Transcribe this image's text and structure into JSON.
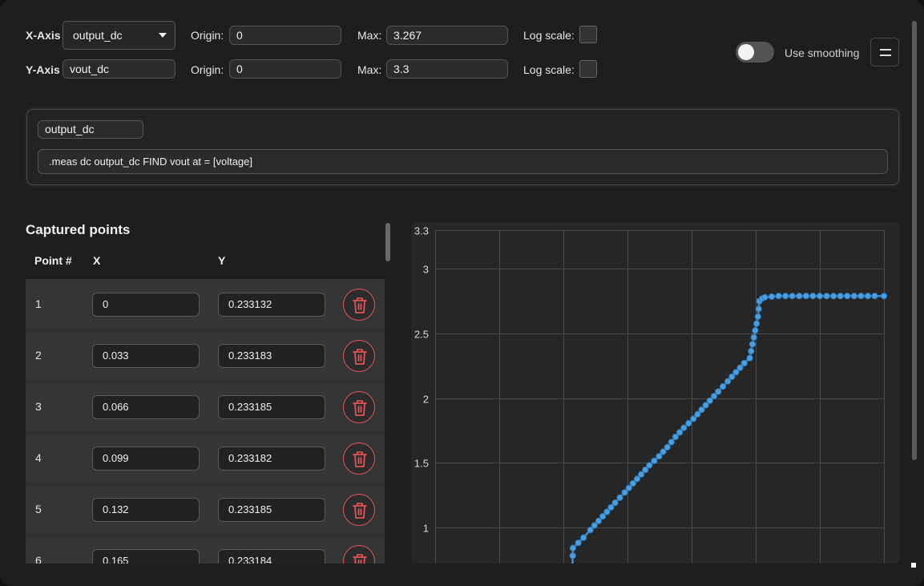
{
  "axes": {
    "x": {
      "label": "X-Axis",
      "selected": "output_dc",
      "origin_label": "Origin:",
      "origin": "0",
      "max_label": "Max:",
      "max": "3.267",
      "log_label": "Log scale:"
    },
    "y": {
      "label": "Y-Axis",
      "value": "vout_dc",
      "origin_label": "Origin:",
      "origin": "0",
      "max_label": "Max:",
      "max": "3.3",
      "log_label": "Log scale:"
    }
  },
  "smoothing_label": "Use smoothing",
  "measurement": {
    "name": "output_dc",
    "command": ".meas dc output_dc FIND vout at = [voltage]"
  },
  "points": {
    "title": "Captured points",
    "headers": {
      "num": "Point #",
      "x": "X",
      "y": "Y"
    },
    "rows": [
      {
        "n": "1",
        "x": "0",
        "y": "0.233132"
      },
      {
        "n": "2",
        "x": "0.033",
        "y": "0.233183"
      },
      {
        "n": "3",
        "x": "0.066",
        "y": "0.233185"
      },
      {
        "n": "4",
        "x": "0.099",
        "y": "0.233182"
      },
      {
        "n": "5",
        "x": "0.132",
        "y": "0.233185"
      },
      {
        "n": "6",
        "x": "0.165",
        "y": "0.233184"
      }
    ]
  },
  "chart_data": {
    "type": "line",
    "xlim": [
      0,
      3.267
    ],
    "ylim": [
      0.72,
      3.3
    ],
    "yticks": [
      "3.3",
      "3",
      "2.5",
      "2",
      "1.5",
      "1"
    ],
    "color": "#3a93d8",
    "grid": true,
    "series": [
      {
        "x": [
          1.0,
          1.003,
          1.08,
          1.13,
          1.19,
          1.25,
          1.31,
          1.38,
          1.44,
          1.5,
          1.56,
          1.63,
          1.69,
          1.75,
          1.81,
          1.88,
          1.94,
          2.0,
          2.06,
          2.13,
          2.19,
          2.25,
          2.29,
          2.35,
          2.36,
          2.38,
          2.4,
          2.45,
          2.5,
          2.6,
          2.7,
          2.8,
          2.9,
          3.0,
          3.1,
          3.2,
          3.267
        ],
        "y": [
          0.72,
          0.84,
          0.92,
          0.98,
          1.05,
          1.12,
          1.19,
          1.27,
          1.34,
          1.41,
          1.48,
          1.55,
          1.62,
          1.7,
          1.77,
          1.84,
          1.91,
          1.98,
          2.05,
          2.13,
          2.2,
          2.27,
          2.31,
          2.63,
          2.75,
          2.77,
          2.78,
          2.785,
          2.79,
          2.79,
          2.79,
          2.79,
          2.79,
          2.79,
          2.79,
          2.79,
          2.79
        ]
      }
    ]
  }
}
